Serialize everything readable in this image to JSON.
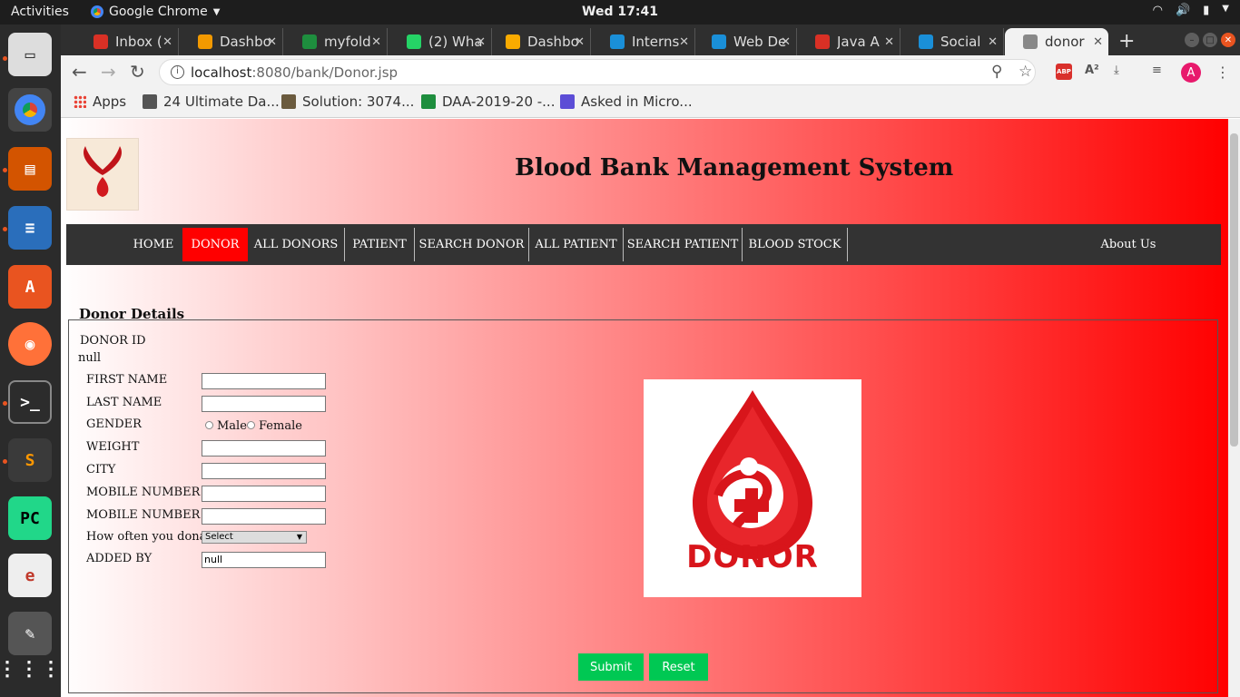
{
  "topbar": {
    "activities": "Activities",
    "app_name": "Google Chrome",
    "clock": "Wed 17:41"
  },
  "browser": {
    "tabs": [
      {
        "label": "Inbox (",
        "icon": "gmail-icon",
        "color": "#d93025"
      },
      {
        "label": "Dashbo",
        "icon": "dashboard-icon",
        "color": "#f29900"
      },
      {
        "label": "myfold",
        "icon": "google-drive-icon",
        "color": "#1e8e3e"
      },
      {
        "label": "(2) Wha",
        "icon": "whatsapp-icon",
        "color": "#25d366"
      },
      {
        "label": "Dashbo",
        "icon": "analytics-icon",
        "color": "#f9ab00"
      },
      {
        "label": "Interns",
        "icon": "internshala-icon",
        "color": "#1a8fd8"
      },
      {
        "label": "Web De",
        "icon": "internshala-icon",
        "color": "#1a8fd8"
      },
      {
        "label": "Java A",
        "icon": "java-icon",
        "color": "#d93025"
      },
      {
        "label": "Social",
        "icon": "internshala-icon",
        "color": "#1a8fd8"
      },
      {
        "label": "donor",
        "icon": "globe-icon",
        "color": "#888888"
      }
    ],
    "url_host": "localhost",
    "url_rest": ":8080/bank/Donor.jsp",
    "bookmarks": [
      {
        "label": "Apps"
      },
      {
        "label": "24 Ultimate Da..."
      },
      {
        "label": "Solution: 3074..."
      },
      {
        "label": "DAA-2019-20 -..."
      },
      {
        "label": "Asked in Micro..."
      }
    ],
    "profile_initial": "A",
    "abp": "ABP"
  },
  "page": {
    "title": "Blood Bank Management System",
    "nav": [
      "HOME",
      "DONOR",
      "ALL DONORS",
      "PATIENT",
      "SEARCH DONOR",
      "ALL PATIENT",
      "SEARCH PATIENT",
      "BLOOD STOCK",
      "About Us"
    ],
    "active_nav": "DONOR",
    "fieldset_legend": "Donor Details",
    "donor_id_label": "DONOR ID",
    "donor_id_value": "null",
    "form": {
      "first_name_label": "FIRST NAME",
      "last_name_label": "LAST NAME",
      "gender_label": "GENDER",
      "gender_male": "Male",
      "gender_female": "Female",
      "weight_label": "WEIGHT",
      "city_label": "CITY",
      "mobile1_label": "MOBILE NUMBER 1",
      "mobile2_label": "MOBILE NUMBER 2",
      "frequency_label": "How often you donate",
      "frequency_selected": "Select",
      "added_by_label": "ADDED BY",
      "added_by_value": "null"
    },
    "image_text": "DONOR",
    "submit": "Submit",
    "reset": "Reset",
    "accent_color": "#ff0000",
    "button_color": "#00c853"
  }
}
